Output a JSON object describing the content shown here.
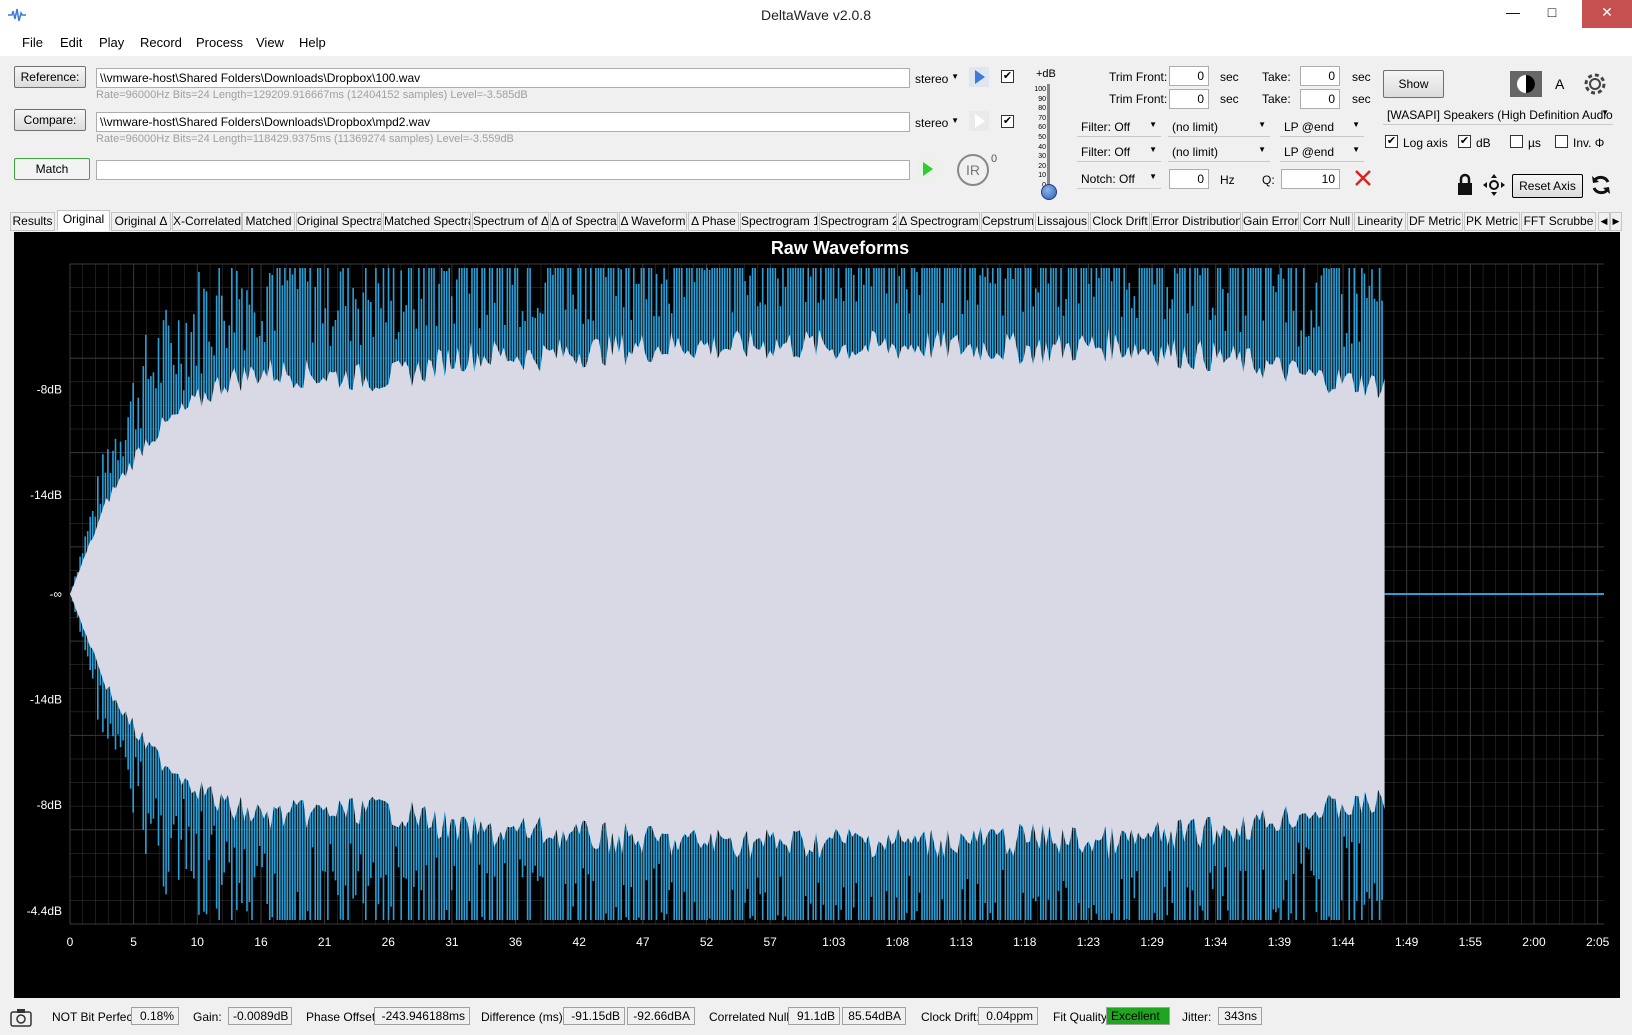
{
  "app": {
    "title": "DeltaWave v2.0.8"
  },
  "window": {
    "minimize": "—",
    "maximize": "□",
    "close": "✕"
  },
  "menu": [
    "File",
    "Edit",
    "Play",
    "Record",
    "Process",
    "View",
    "Help"
  ],
  "reference": {
    "button": "Reference:",
    "path": "\\\\vmware-host\\Shared Folders\\Downloads\\Dropbox\\100.wav",
    "info": "Rate=96000Hz Bits=24 Length=129209.916667ms (12404152 samples) Level=-3.585dB",
    "channel": "stereo",
    "checked": true
  },
  "compare": {
    "button": "Compare:",
    "path": "\\\\vmware-host\\Shared Folders\\Downloads\\Dropbox\\mpd2.wav",
    "info": "Rate=96000Hz Bits=24 Length=118429.9375ms (11369274 samples) Level=-3.559dB",
    "channel": "stereo",
    "checked": true
  },
  "match": {
    "button": "Match",
    "value": ""
  },
  "ir": {
    "label": "IR",
    "sup": "0"
  },
  "level_meter": {
    "label": "+dB",
    "ticks": [
      "100",
      "90",
      "80",
      "70",
      "60",
      "50",
      "40",
      "30",
      "20",
      "10",
      "0"
    ],
    "value": 0
  },
  "trim": {
    "row1": {
      "label": "Trim Front:",
      "value": "0",
      "unit": "sec",
      "take_label": "Take:",
      "take_value": "0",
      "take_unit": "sec"
    },
    "row2": {
      "label": "Trim Front:",
      "value": "0",
      "unit": "sec",
      "take_label": "Take:",
      "take_value": "0",
      "take_unit": "sec"
    }
  },
  "filters": {
    "row1": {
      "filter": "Filter: Off",
      "limit": "(no limit)",
      "lp": "LP @end"
    },
    "row2": {
      "filter": "Filter: Off",
      "limit": "(no limit)",
      "lp": "LP @end"
    },
    "notch": {
      "label": "Notch: Off",
      "value": "0",
      "unit": "Hz",
      "q_label": "Q:",
      "q_value": "10"
    }
  },
  "output": {
    "show_button": "Show",
    "a_label": "A",
    "device": "[WASAPI] Speakers (High Definition Audio D",
    "log_axis": {
      "label": "Log axis",
      "checked": true
    },
    "db": {
      "label": "dB",
      "checked": true
    },
    "us": {
      "label": "µs",
      "checked": false
    },
    "inv": {
      "label": "Inv. Φ",
      "checked": false
    },
    "reset_axis": "Reset Axis"
  },
  "tabs": [
    "Results",
    "Original",
    "Original Δ",
    "X-Correlated",
    "Matched",
    "Original Spectra",
    "Matched Spectra",
    "Spectrum of Δ",
    "Δ of Spectra",
    "Δ Waveform",
    "Δ Phase",
    "Spectrogram 1",
    "Spectrogram 2",
    "Δ Spectrogram",
    "Cepstrum",
    "Lissajous",
    "Clock Drift",
    "Error Distribution",
    "Gain Error",
    "Corr Null",
    "Linearity",
    "DF Metric",
    "PK Metric",
    "FFT Scrubbe"
  ],
  "active_tab": 1,
  "chart_data": {
    "type": "area",
    "title": "Raw Waveforms",
    "y_tick_labels": [
      "-8dB",
      "-14dB",
      "-∞",
      "-14dB",
      "-8dB",
      "-4.4dB"
    ],
    "x_tick_labels": [
      "0",
      "5",
      "10",
      "16",
      "21",
      "26",
      "31",
      "36",
      "42",
      "47",
      "52",
      "57",
      "1:03",
      "1:08",
      "1:13",
      "1:18",
      "1:23",
      "1:29",
      "1:34",
      "1:39",
      "1:44",
      "1:49",
      "1:55",
      "2:00",
      "2:05"
    ],
    "colors": {
      "reference": "#d9d9e6",
      "compare": "#2a9fd6",
      "background": "#000000",
      "grid": "#3a3a3a"
    },
    "series": [
      {
        "envelope_upper_dB": [
          -60,
          -40,
          -28,
          -22,
          -16,
          -14,
          -14.5,
          -15,
          -15.5,
          -14,
          -11,
          -10.5,
          -11,
          -10,
          -9.5,
          -9,
          -8.5,
          -9,
          -8.5,
          -8.5,
          -9,
          -9,
          -8.5,
          -9,
          -9,
          -9.5,
          -9,
          -8.5,
          -9.5,
          -10.5,
          -11.5,
          -13,
          -15,
          -16,
          -17
        ]
      }
    ]
  },
  "status_bar": {
    "not_bit_perfect": "NOT Bit Perfect",
    "not_bit_perfect_value": "0.18%",
    "gain_label": "Gain:",
    "gain_value": "-0.0089dB",
    "phase_label": "Phase Offset:",
    "phase_value": "-243.946188ms",
    "diff_label": "Difference (ms):",
    "diff_value1": "-91.15dB",
    "diff_value2": "-92.66dBA",
    "corr_label": "Correlated Null:",
    "corr_value1": "91.1dB",
    "corr_value2": "85.54dBA",
    "drift_label": "Clock Drift:",
    "drift_value": "0.04ppm",
    "fit_label": "Fit Quality:",
    "fit_value": "Excellent",
    "jitter_label": "Jitter:",
    "jitter_value": "343ns"
  }
}
